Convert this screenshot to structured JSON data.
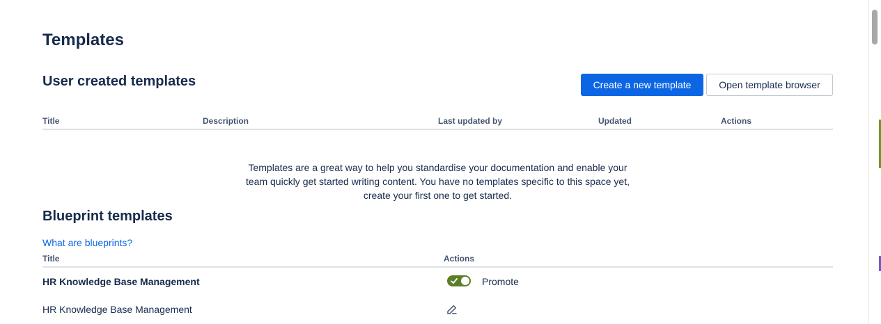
{
  "page": {
    "title": "Templates"
  },
  "user_templates": {
    "section_title": "User created templates",
    "create_button_label": "Create a new template",
    "browser_button_label": "Open template browser",
    "columns": [
      "Title",
      "Description",
      "Last updated by",
      "Updated",
      "Actions"
    ],
    "empty_message": "Templates are a great way to help you standardise your documentation and enable your team quickly get started writing content. You have no templates specific to this space yet, create your first one to get started."
  },
  "blueprint_templates": {
    "section_title": "Blueprint templates",
    "help_link": "What are blueprints?",
    "columns": [
      "Title",
      "Actions"
    ],
    "rows": [
      {
        "title": "HR Knowledge Base Management",
        "bold": true,
        "action_type": "toggle",
        "toggle_on": true,
        "action_label": "Promote",
        "toggle_color": "#5b7f24"
      },
      {
        "title": "HR Knowledge Base Management",
        "bold": false,
        "action_type": "edit",
        "icon": "edit-icon"
      }
    ]
  },
  "colors": {
    "primary": "#0c66e4",
    "text": "#172b4d",
    "subtle_text": "#44546f",
    "divider": "#dfe1e6"
  }
}
